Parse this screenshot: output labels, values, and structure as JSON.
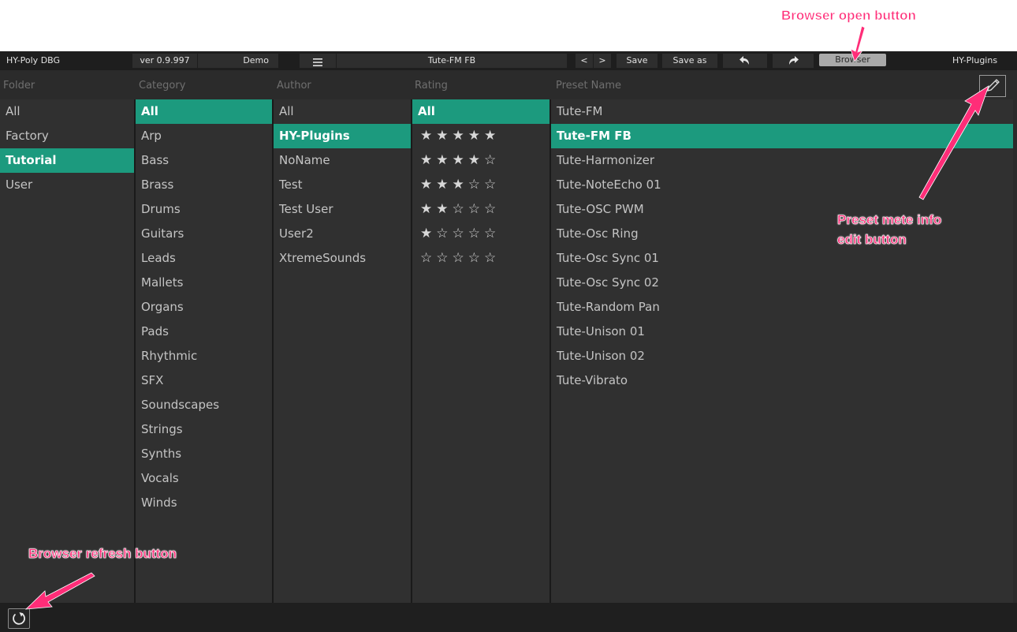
{
  "annotations": {
    "browser_open": "Browser open button",
    "preset_edit_line1": "Preset mete info",
    "preset_edit_line2": "edit button",
    "refresh": "Browser refresh button"
  },
  "topbar": {
    "plugin_name": "HY-Poly DBG",
    "version": "ver 0.9.997",
    "mode": "Demo",
    "menu_icon": "hamburger-icon",
    "preset_name": "Tute-FM FB",
    "prev_label": "<",
    "next_label": ">",
    "save_label": "Save",
    "save_as_label": "Save as",
    "undo_icon": "undo-icon",
    "redo_icon": "redo-icon",
    "browser_label": "Browser",
    "vendor": "HY-Plugins"
  },
  "columns": {
    "folder": {
      "header": "Folder",
      "items": [
        "All",
        "Factory",
        "Tutorial",
        "User"
      ],
      "selected": "Tutorial"
    },
    "category": {
      "header": "Category",
      "items": [
        "All",
        "Arp",
        "Bass",
        "Brass",
        "Drums",
        "Guitars",
        "Leads",
        "Mallets",
        "Organs",
        "Pads",
        "Rhythmic",
        "SFX",
        "Soundscapes",
        "Strings",
        "Synths",
        "Vocals",
        "Winds"
      ],
      "selected": "All"
    },
    "author": {
      "header": "Author",
      "items": [
        "All",
        "HY-Plugins",
        "NoName",
        "Test",
        "Test User",
        "User2",
        "XtremeSounds"
      ],
      "selected": "HY-Plugins"
    },
    "rating": {
      "header": "Rating",
      "items": [
        "All",
        "★★★★★",
        "★★★★☆",
        "★★★☆☆",
        "★★☆☆☆",
        "★☆☆☆☆",
        "☆☆☆☆☆"
      ],
      "selected": "All"
    },
    "preset": {
      "header": "Preset Name",
      "items": [
        "Tute-FM",
        "Tute-FM FB",
        "Tute-Harmonizer",
        "Tute-NoteEcho 01",
        "Tute-OSC PWM",
        "Tute-Osc Ring",
        "Tute-Osc Sync 01",
        "Tute-Osc Sync 02",
        "Tute-Random Pan",
        "Tute-Unison 01",
        "Tute-Unison 02",
        "Tute-Vibrato"
      ],
      "selected": "Tute-FM FB"
    }
  },
  "icons": {
    "edit": "pencil-icon",
    "refresh": "refresh-icon"
  },
  "colors": {
    "accent": "#1c9a7e",
    "annotation": "#ff2d78"
  }
}
